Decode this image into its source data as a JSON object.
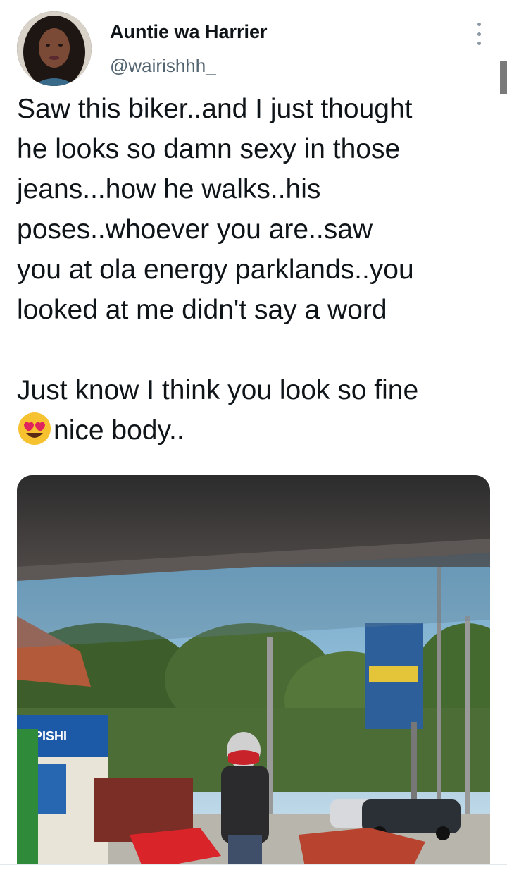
{
  "tweet": {
    "author_name": "Auntie wa Harrier",
    "author_handle": "@wairishhh_",
    "lines": [
      "Saw this biker..and I just thought",
      "he looks so damn sexy in those",
      "jeans...how he walks..his",
      "poses..whoever you are..saw",
      "you at ola energy parklands..you",
      "looked at me didn't say a word"
    ],
    "line2_a": "Just know I think you look so fine",
    "line2_b": "nice body..",
    "emoji": "heart-eyes-emoji"
  },
  "media": {
    "sign_text": "PISHI"
  },
  "icons": {
    "more": "more-options-icon"
  },
  "colors": {
    "text": "#0f1419",
    "secondary": "#536471",
    "icon": "#8b98a5"
  }
}
